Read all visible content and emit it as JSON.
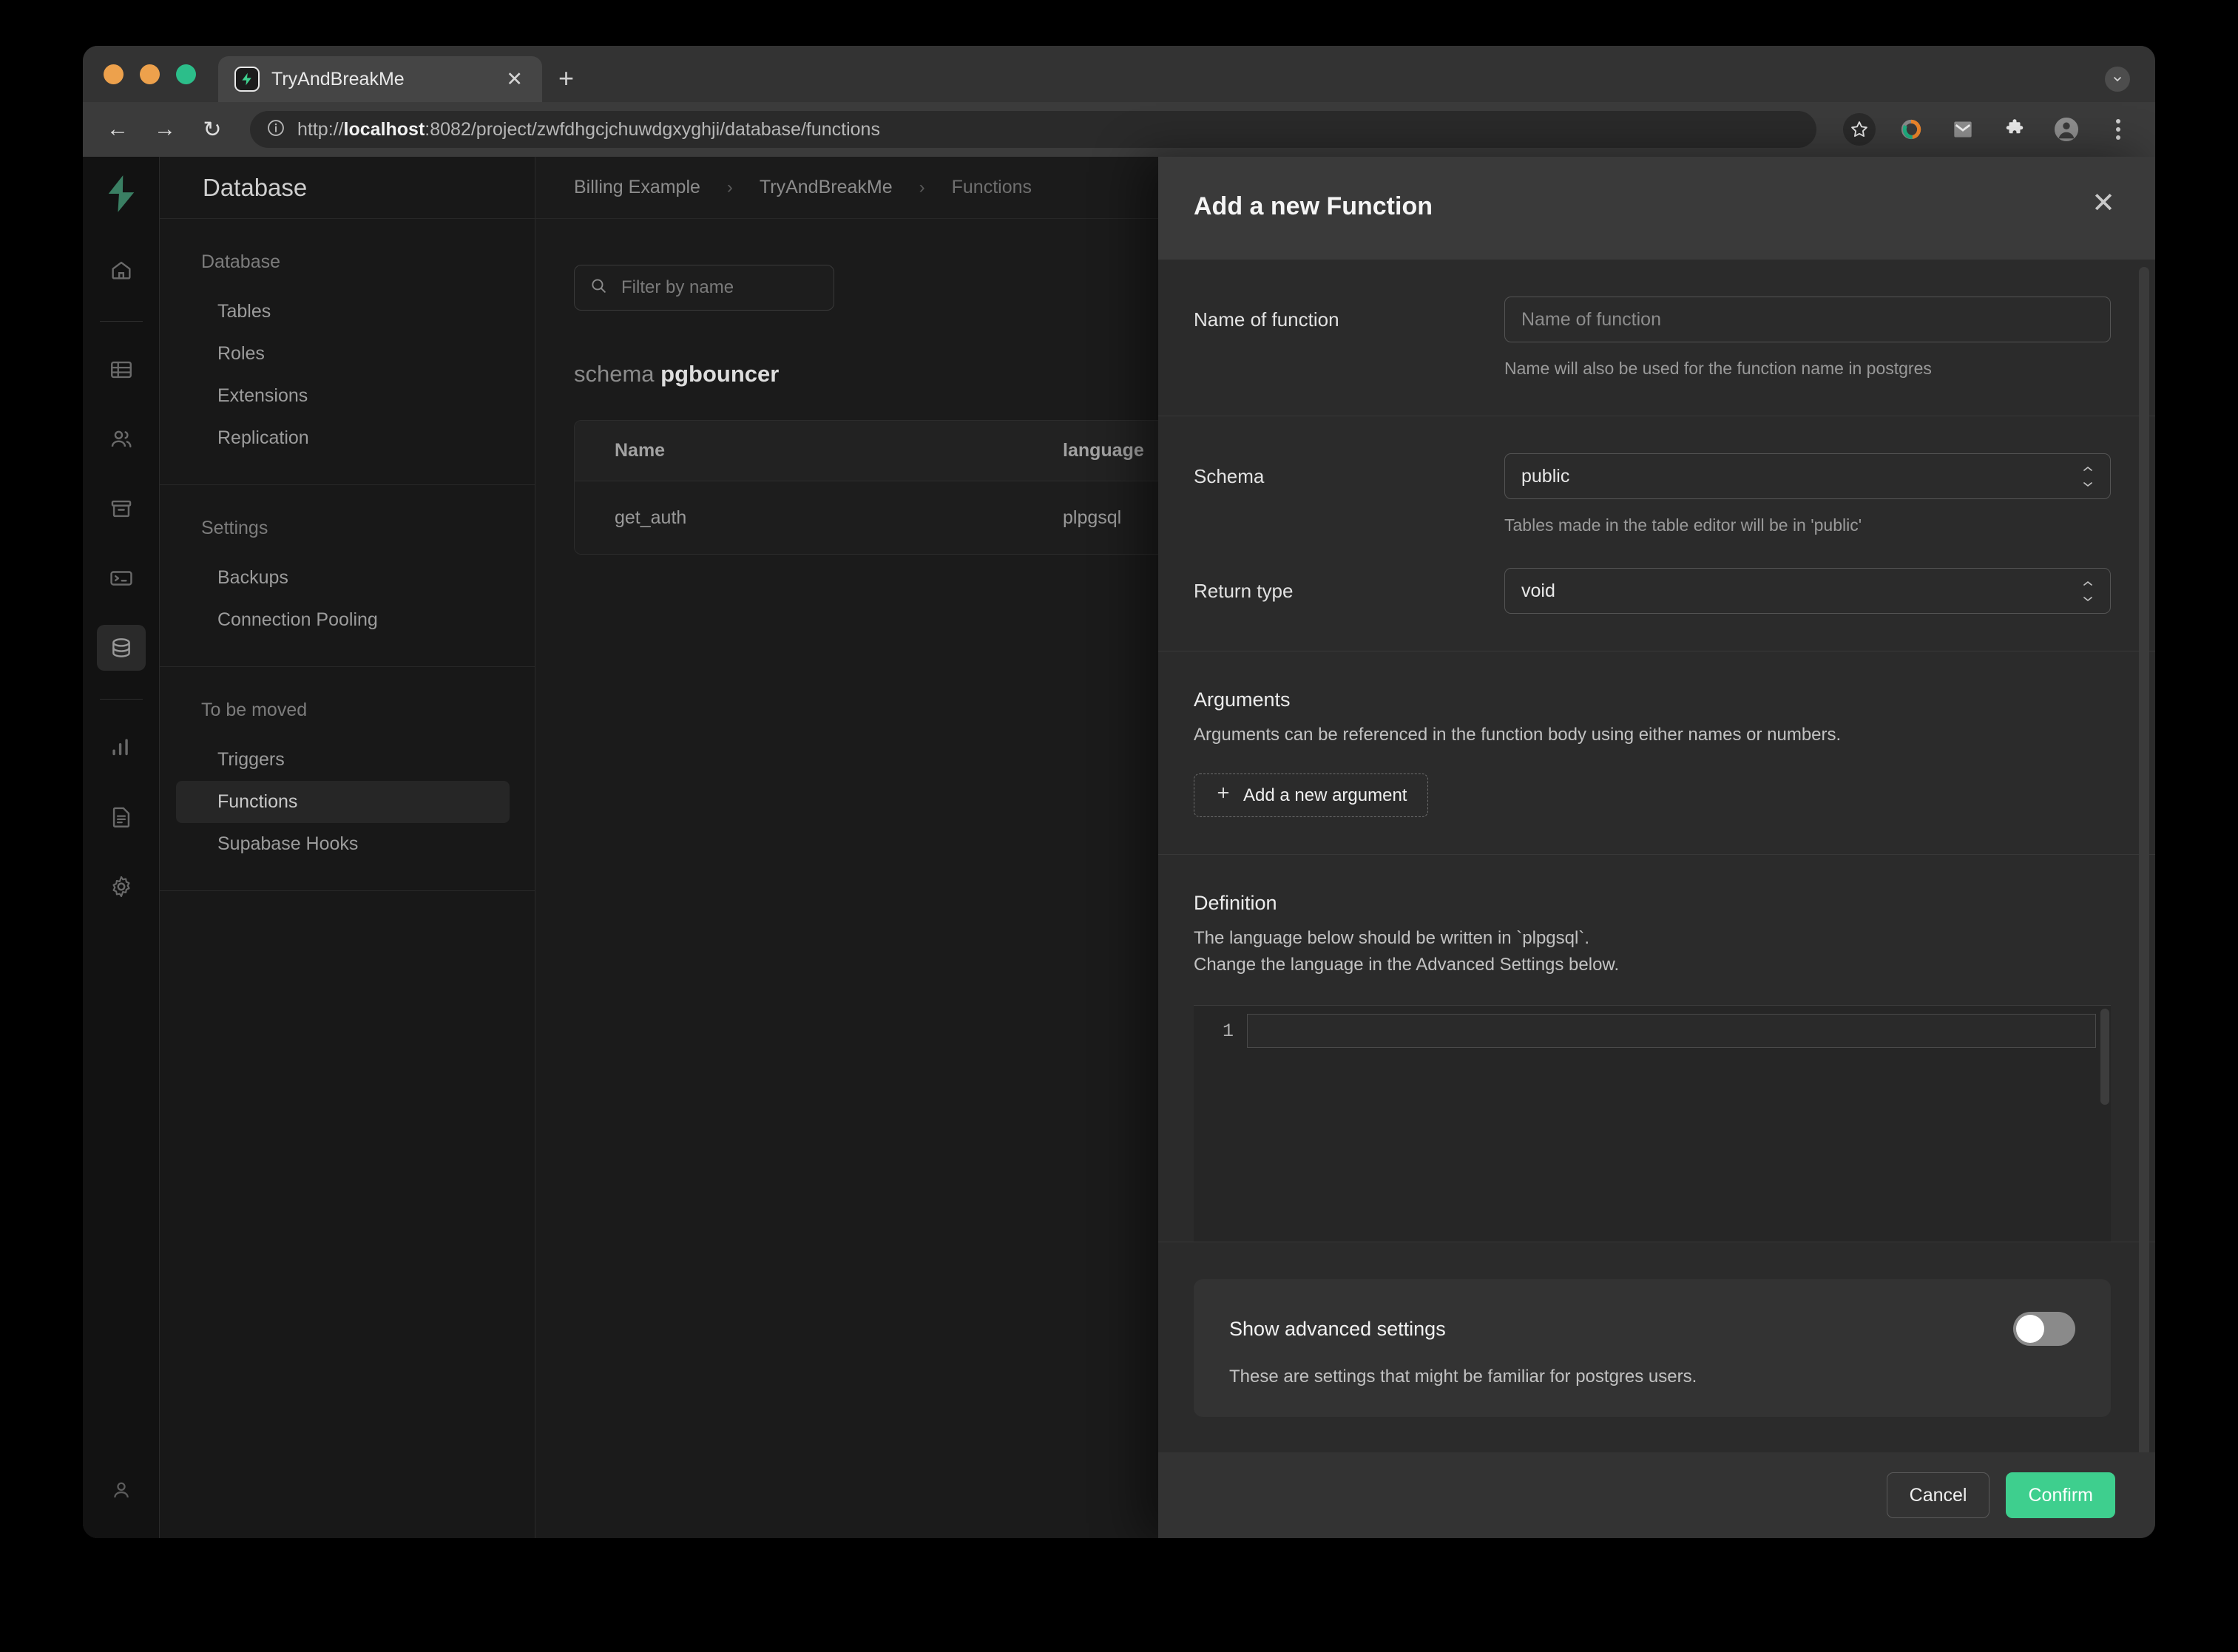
{
  "browser": {
    "tab": {
      "title": "TryAndBreakMe",
      "favicon": "lightning-bolt-icon",
      "close_label": "✕"
    },
    "new_tab_label": "+",
    "nav": {
      "back": "←",
      "forward": "→",
      "reload": "↻"
    },
    "url": {
      "scheme": "http://",
      "host": "localhost",
      "rest": ":8082/project/zwfdhgcjchuwdgxyghji/database/functions"
    },
    "toolbar_icons": [
      "bookmark-star-icon",
      "donut-extension-icon",
      "gmail-icon",
      "puzzle-extension-icon",
      "profile-avatar",
      "kebab-menu-icon"
    ]
  },
  "rail": {
    "logo": "supabase-logo",
    "items": [
      {
        "name": "home",
        "active": false
      },
      {
        "name": "table-editor",
        "active": false
      },
      {
        "name": "authentication",
        "active": false
      },
      {
        "name": "storage",
        "active": false
      },
      {
        "name": "sql-editor",
        "active": false
      },
      {
        "name": "database",
        "active": true
      },
      {
        "name": "reports",
        "active": false
      },
      {
        "name": "logs",
        "active": false
      },
      {
        "name": "settings",
        "active": false
      }
    ],
    "user": "account-icon"
  },
  "sidebar": {
    "title": "Database",
    "groups": [
      {
        "label": "Database",
        "items": [
          {
            "label": "Tables",
            "active": false
          },
          {
            "label": "Roles",
            "active": false
          },
          {
            "label": "Extensions",
            "active": false
          },
          {
            "label": "Replication",
            "active": false
          }
        ]
      },
      {
        "label": "Settings",
        "items": [
          {
            "label": "Backups",
            "active": false
          },
          {
            "label": "Connection Pooling",
            "active": false
          }
        ]
      },
      {
        "label": "To be moved",
        "items": [
          {
            "label": "Triggers",
            "active": false
          },
          {
            "label": "Functions",
            "active": true
          },
          {
            "label": "Supabase Hooks",
            "active": false
          }
        ]
      }
    ]
  },
  "breadcrumb": {
    "org": "Billing Example",
    "project": "TryAndBreakMe",
    "page": "Functions",
    "separator": "›"
  },
  "main": {
    "filter_placeholder": "Filter by name",
    "schema_prefix": "schema",
    "schema_name": "pgbouncer",
    "table": {
      "columns": [
        "Name",
        "language"
      ],
      "rows": [
        {
          "name": "get_auth",
          "language": "plpgsql"
        }
      ]
    }
  },
  "panel": {
    "title": "Add a new Function",
    "close_label": "✕",
    "name_field": {
      "label": "Name of function",
      "value": "",
      "placeholder": "Name of function",
      "help": "Name will also be used for the function name in postgres"
    },
    "schema_field": {
      "label": "Schema",
      "value": "public",
      "help": "Tables made in the table editor will be in 'public'"
    },
    "return_field": {
      "label": "Return type",
      "value": "void"
    },
    "arguments": {
      "title": "Arguments",
      "description": "Arguments can be referenced in the function body using either names or numbers.",
      "add_button": "Add a new argument",
      "add_icon": "plus-icon"
    },
    "definition": {
      "title": "Definition",
      "line1": "The language below should be written in `plpgsql`.",
      "line2": "Change the language in the Advanced Settings below.",
      "editor_line_number": "1",
      "editor_value": ""
    },
    "advanced": {
      "title": "Show advanced settings",
      "toggle_state": "off",
      "description": "These are settings that might be familiar for postgres users."
    },
    "footer": {
      "cancel": "Cancel",
      "confirm": "Confirm"
    }
  },
  "colors": {
    "accent_green": "#3ECF8E",
    "panel_bg": "#2B2B2B",
    "panel_header_bg": "#3A3A3A"
  }
}
